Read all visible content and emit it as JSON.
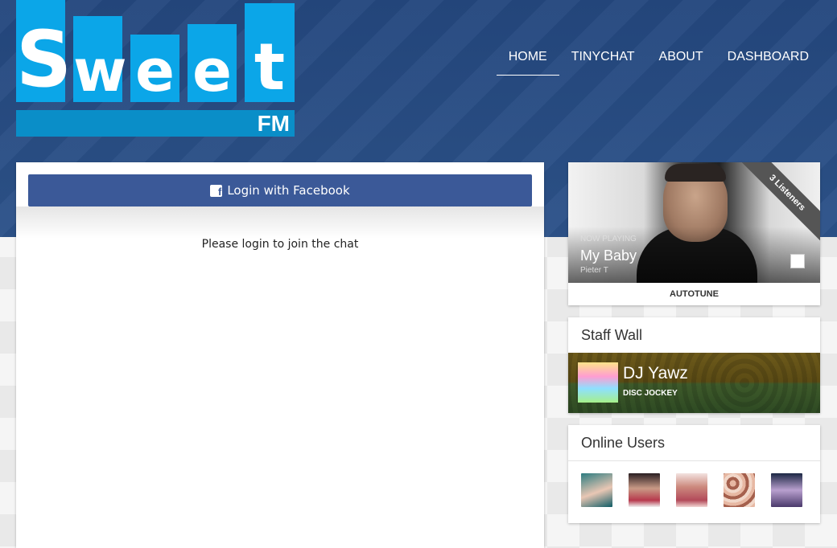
{
  "brand": {
    "logo_letters": [
      "S",
      "w",
      "e",
      "e",
      "t"
    ],
    "logo_sub": "FM",
    "accent_color": "#0ba6e8"
  },
  "nav": {
    "items": [
      {
        "label": "HOME",
        "active": true
      },
      {
        "label": "TINYCHAT",
        "active": false
      },
      {
        "label": "ABOUT",
        "active": false
      },
      {
        "label": "DASHBOARD",
        "active": false
      }
    ]
  },
  "chat": {
    "login_button": "Login with Facebook",
    "facebook_icon": "facebook-icon",
    "facebook_color": "#3b5998",
    "message": "Please login to join the chat"
  },
  "now_playing": {
    "label": "NOW PLAYING",
    "song": "My Baby",
    "artist": "Pieter T",
    "listeners": "3 Listeners",
    "show": "AUTOTUNE"
  },
  "staff_wall": {
    "title": "Staff Wall",
    "name": "DJ Yawz",
    "role": "DISC JOCKEY"
  },
  "online_users": {
    "title": "Online Users",
    "count": 5
  }
}
